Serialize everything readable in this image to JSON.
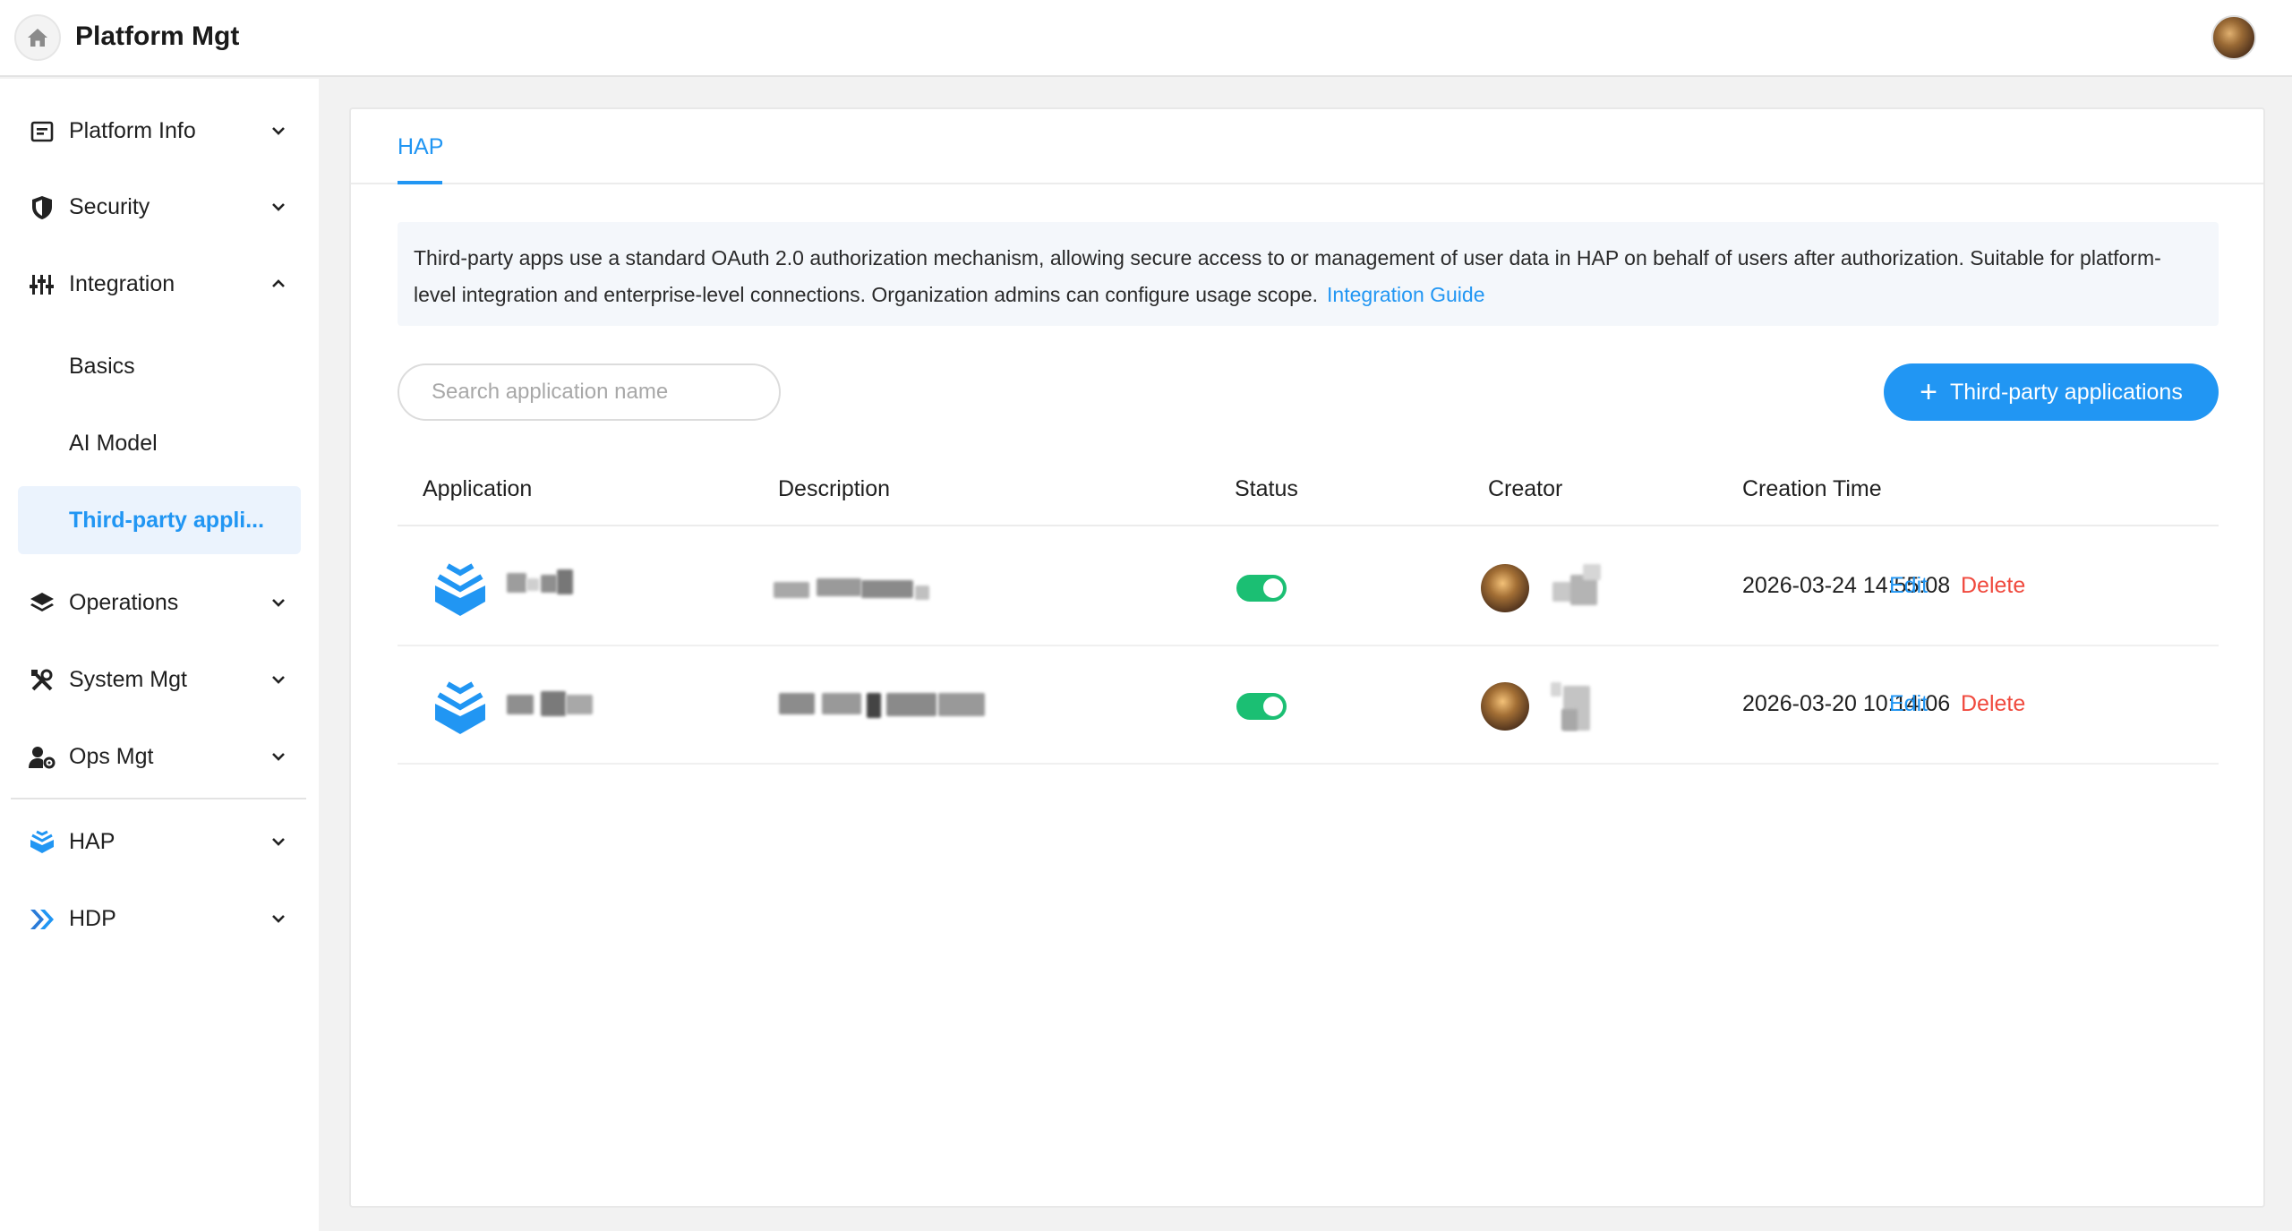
{
  "header": {
    "title": "Platform Mgt"
  },
  "sidebar": {
    "items": [
      {
        "label": "Platform Info"
      },
      {
        "label": "Security"
      },
      {
        "label": "Integration"
      },
      {
        "label": "Basics"
      },
      {
        "label": "AI Model"
      },
      {
        "label": "Third-party appli..."
      },
      {
        "label": "Operations"
      },
      {
        "label": "System Mgt"
      },
      {
        "label": "Ops Mgt"
      },
      {
        "label": "HAP"
      },
      {
        "label": "HDP"
      }
    ]
  },
  "main": {
    "tab": "HAP",
    "notice_text": "Third-party apps use a standard OAuth 2.0 authorization mechanism, allowing secure access to or management of user data in HAP on behalf of users after authorization. Suitable for platform-level integration and enterprise-level connections. Organization admins can configure usage scope.",
    "notice_link": "Integration Guide",
    "search_placeholder": "Search application name",
    "add_button_label": "Third-party applications",
    "table": {
      "headers": [
        "Application",
        "Description",
        "Status",
        "Creator",
        "Creation Time"
      ],
      "rows": [
        {
          "creation_time": "2026-03-24 14:55:08",
          "status_on": true,
          "edit_label": "Edit",
          "delete_label": "Delete"
        },
        {
          "creation_time": "2026-03-20 10:14:06",
          "status_on": true,
          "edit_label": "Edit",
          "delete_label": "Delete"
        }
      ]
    }
  },
  "colors": {
    "accent": "#2196f3",
    "toggle_on": "#1bbf73",
    "danger": "#f04a3e"
  }
}
